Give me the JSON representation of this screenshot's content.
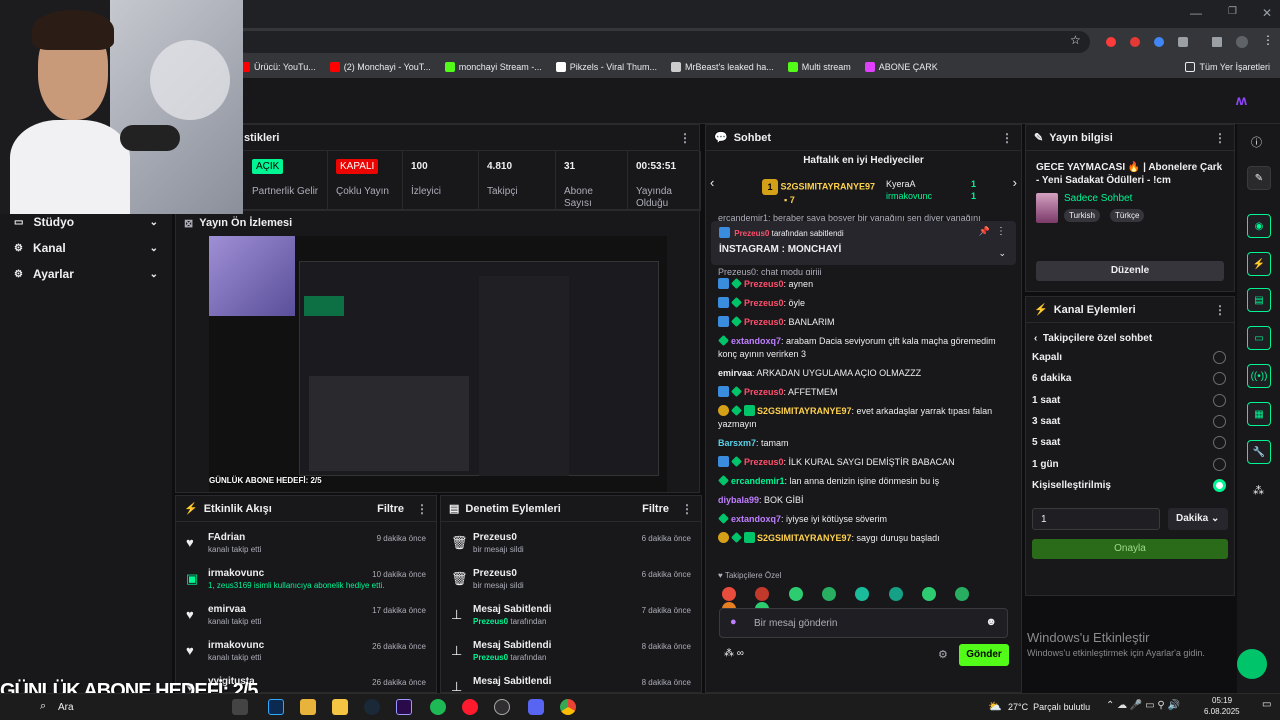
{
  "browser": {
    "bookmarks": [
      {
        "label": "Ürücü: YouTu...",
        "color": "#ff0000"
      },
      {
        "label": "(2) Monchayi - YouT...",
        "color": "#ff0000"
      },
      {
        "label": "monchayi Stream -...",
        "color": "#53fc18"
      },
      {
        "label": "Pikzels - Viral Thum...",
        "color": "#ffffff"
      },
      {
        "label": "MrBeast's leaked ha...",
        "color": "#cccccc"
      },
      {
        "label": "Multi stream",
        "color": "#53fc18"
      },
      {
        "label": "ABONE ÇARK",
        "color": "#e040fb"
      }
    ],
    "all_bookmarks": "Tüm Yer İşaretleri"
  },
  "stats": {
    "title": "stikleri",
    "items": [
      {
        "value": "AÇIK",
        "label": "Partnerlik Gelir",
        "type": "badge-green"
      },
      {
        "value": "KAPALI",
        "label": "Çoklu Yayın",
        "type": "badge-red"
      },
      {
        "value": "100",
        "label": "İzleyici"
      },
      {
        "value": "4.810",
        "label": "Takipçi"
      },
      {
        "value": "31",
        "label": "Abone Sayısı"
      },
      {
        "value": "00:53:51",
        "label": "Yayında Olduğu"
      }
    ]
  },
  "sidebar": {
    "items": [
      {
        "label": "Stüdyo"
      },
      {
        "label": "Kanal"
      },
      {
        "label": "Ayarlar"
      }
    ]
  },
  "preview": {
    "title": "Yayın Ön İzlemesi",
    "overlay_text": "GÜNLÜK ABONE HEDEFİ: 2/5"
  },
  "overlay": {
    "goal_text": "GÜNLÜK ABONE HEDEFİ: 2/5"
  },
  "activity": {
    "title": "Etkinlik Akışı",
    "filter": "Filtre",
    "items": [
      {
        "name": "FAdrian",
        "desc": "kanalı takip etti",
        "time": "9 dakika önce",
        "icon": "heart"
      },
      {
        "name": "irmakovunc",
        "desc": "1, zeus3169 isimli kullanıcıya abonelik hediye etti.",
        "time": "10 dakika önce",
        "icon": "gift"
      },
      {
        "name": "emirvaa",
        "desc": "kanalı takip etti",
        "time": "17 dakika önce",
        "icon": "heart"
      },
      {
        "name": "irmakovunc",
        "desc": "kanalı takip etti",
        "time": "26 dakika önce",
        "icon": "heart"
      },
      {
        "name": "yyigitusta",
        "desc": "",
        "time": "26 dakika önce",
        "icon": "heart"
      }
    ]
  },
  "moderation": {
    "title": "Denetim Eylemleri",
    "filter": "Filtre",
    "items": [
      {
        "name": "Prezeus0",
        "desc": "bir mesajı sildi",
        "time": "6 dakika önce",
        "icon": "trash"
      },
      {
        "name": "Prezeus0",
        "desc": "bir mesajı sildi",
        "time": "6 dakika önce",
        "icon": "trash"
      },
      {
        "name": "Mesaj Sabitlendi",
        "by": "Prezeus0",
        "desc": "tarafından",
        "time": "7 dakika önce",
        "icon": "pin"
      },
      {
        "name": "Mesaj Sabitlendi",
        "by": "Prezeus0",
        "desc": "tarafından",
        "time": "8 dakika önce",
        "icon": "pin"
      },
      {
        "name": "Mesaj Sabitlendi",
        "by": "",
        "desc": "",
        "time": "8 dakika önce",
        "icon": "pin"
      }
    ]
  },
  "chat": {
    "title": "Sohbet",
    "gifters_title": "Haftalık en iyi Hediyeciler",
    "top_gifter": {
      "rank": "1",
      "name": "S2GSIMITAYRANYE97",
      "count": "7"
    },
    "other_gifters": [
      {
        "name": "KyeraA",
        "count": "1"
      },
      {
        "name": "irmakovunc",
        "count": "1"
      }
    ],
    "pinned_by": "Prezeus0",
    "pinned_by_suffix": "tarafından sabitlendi",
    "pinned_message": "İNSTAGRAM : MONCHAYİ",
    "partial_top": "ercandemir1: beraber saya boşver bir yanağını sen diyer yanağını",
    "partial_second": "Prezeus0: chat modu giriii",
    "messages": [
      {
        "user": "Prezeus0",
        "text": "aynen",
        "color": "#ff4f6b",
        "badges": "mod"
      },
      {
        "user": "Prezeus0",
        "text": "öyle",
        "color": "#ff4f6b",
        "badges": "mod"
      },
      {
        "user": "Prezeus0",
        "text": "BANLARIM",
        "color": "#ff4f6b",
        "badges": "mod"
      },
      {
        "user": "extandoxq7",
        "text": "arabam Dacia seviyorum çift kala maçha göremedim konç ayının verirken 3",
        "color": "#bf7fff",
        "badges": "vip"
      },
      {
        "user": "emirvaa",
        "text": "ARKADAN UYGULAMA AÇIO OLMAZZZ",
        "color": "#efeff1",
        "badges": ""
      },
      {
        "user": "Prezeus0",
        "text": "AFFETMEM",
        "color": "#ff4f6b",
        "badges": "mod"
      },
      {
        "user": "S2GSIMITAYRANYE97",
        "text": "evet arkadaşlar yarrak tıpası falan yazmayın",
        "color": "#ffd24d",
        "badges": "gift"
      },
      {
        "user": "Barsxm7",
        "text": "tamam",
        "color": "#5ad1e6",
        "badges": ""
      },
      {
        "user": "Prezeus0",
        "text": "İLK KURAL SAYGI DEMİŞTİR BABACAN",
        "color": "#ff4f6b",
        "badges": "mod"
      },
      {
        "user": "ercandemir1",
        "text": "lan anna denizin işine dönmesin bu iş",
        "color": "#00f593",
        "badges": "vip"
      },
      {
        "user": "diybala99",
        "text": "BOK GİBİ",
        "color": "#bf7fff",
        "badges": ""
      },
      {
        "user": "extandoxq7",
        "text": "iyiyse iyi kötüyse söverim",
        "color": "#bf7fff",
        "badges": "vip"
      },
      {
        "user": "S2GSIMITAYRANYE97",
        "text": "saygı duruşu başladı",
        "color": "#ffd24d",
        "badges": "gift"
      }
    ],
    "followers_only": "Takipçilere Özel",
    "input_placeholder": "Bir mesaj gönderin",
    "send": "Gönder"
  },
  "stream_info": {
    "title": "Yayın bilgisi",
    "stream_title": "GECE YAYMACASI 🔥 | Abonelere Çark - Yeni Sadakat Ödülleri - !cm",
    "category": "Sadece Sohbet",
    "tags": [
      "Turkish",
      "Türkçe"
    ],
    "edit": "Düzenle"
  },
  "channel_actions": {
    "title": "Kanal Eylemleri",
    "sub_title": "Takipçilere özel sohbet",
    "options": [
      "Kapalı",
      "6 dakika",
      "1 saat",
      "3 saat",
      "5 saat",
      "1 gün",
      "Kişiselleştirilmiş"
    ],
    "selected": 6,
    "custom_value": "1",
    "unit": "Dakika",
    "confirm": "Onayla"
  },
  "windows_watermark": {
    "title": "Windows'u Etkinleştir",
    "subtitle": "Windows'u etkinleştirmek için Ayarlar'a gidin."
  },
  "taskbar": {
    "search": "Ara",
    "weather": "27°C  Parçalı bulutlu",
    "time": "05:19",
    "date": "6.08.2025"
  }
}
